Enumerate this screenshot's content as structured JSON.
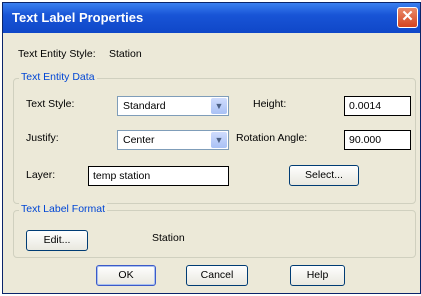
{
  "dialog": {
    "title": "Text Label Properties",
    "close_glyph": "✕",
    "entity_style_label": "Text Entity Style:",
    "entity_style_value": "Station"
  },
  "entity_data": {
    "legend": "Text Entity Data",
    "text_style_label": "Text Style:",
    "text_style_value": "Standard",
    "justify_label": "Justify:",
    "justify_value": "Center",
    "layer_label": "Layer:",
    "layer_value": "temp station",
    "height_label": "Height:",
    "height_value": "0.0014",
    "rotation_label": "Rotation Angle:",
    "rotation_value": "90.000",
    "select_button": "Select..."
  },
  "label_format": {
    "legend": "Text Label Format",
    "edit_button": "Edit...",
    "value": "Station"
  },
  "buttons": {
    "ok": "OK",
    "cancel": "Cancel",
    "help": "Help"
  },
  "icons": {
    "dropdown_glyph": "▼"
  }
}
